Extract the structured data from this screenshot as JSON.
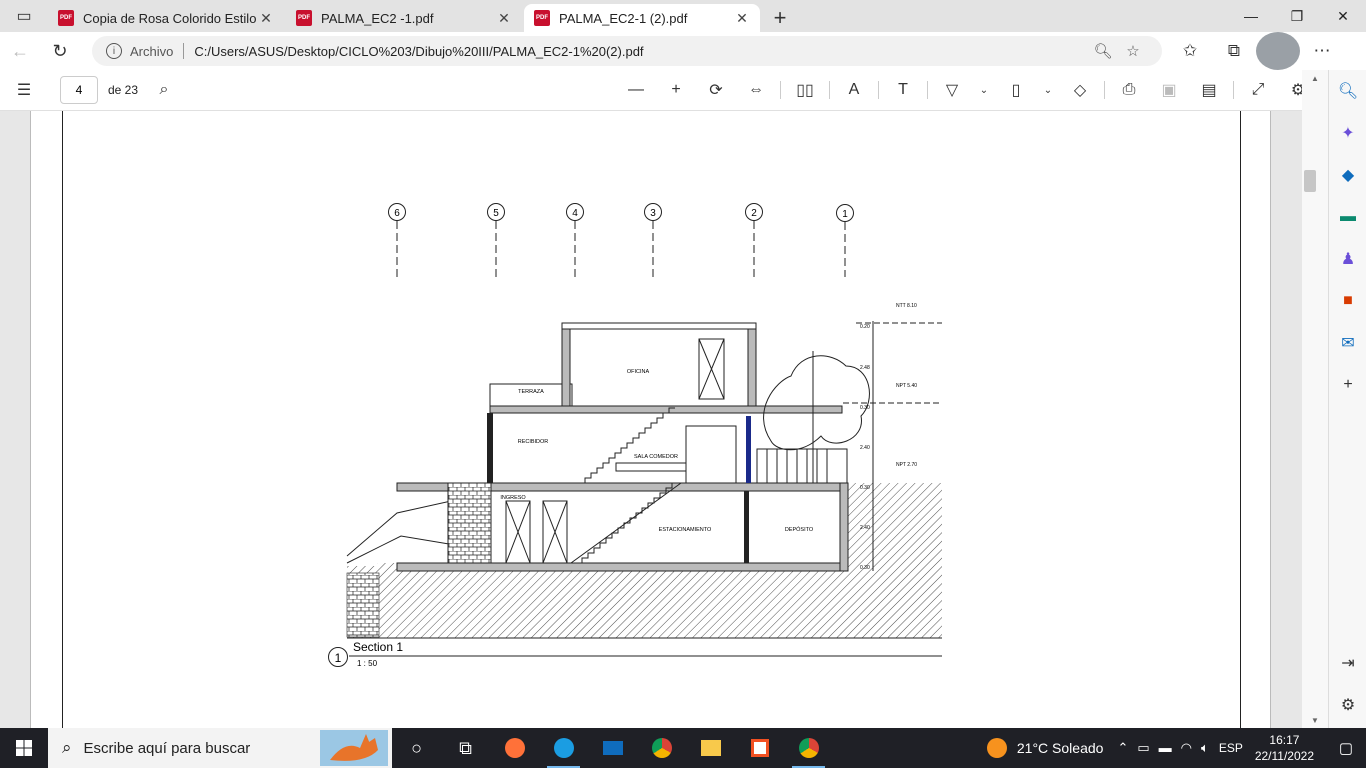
{
  "tabs": [
    {
      "title": "Copia de Rosa Colorido Estilo Se",
      "active": false
    },
    {
      "title": "PALMA_EC2 -1.pdf",
      "active": false
    },
    {
      "title": "PALMA_EC2-1 (2).pdf",
      "active": true
    }
  ],
  "address": {
    "label": "Archivo",
    "url": "C:/Users/ASUS/Desktop/CICLO%203/Dibujo%20III/PALMA_EC2-1%20(2).pdf"
  },
  "pdf_toolbar": {
    "page_number": "4",
    "page_total": "de 23"
  },
  "drawing": {
    "axes": [
      "6",
      "5",
      "4",
      "3",
      "2",
      "1"
    ],
    "levels": [
      "NTT 8.10",
      "NPT 5.40",
      "NPT 2.70"
    ],
    "dims": [
      "0.20",
      "2.48",
      "0.30",
      "2.40",
      "0.30",
      "2.40",
      "0.30"
    ],
    "rooms": [
      "OFICINA",
      "TERRAZA",
      "RECIBIDOR",
      "SALA COMEDOR",
      "INGRESO",
      "ESTACIONAMIENTO",
      "DEPÓSITO"
    ],
    "section_number": "1",
    "section_title": "Section 1",
    "scale": "1 : 50"
  },
  "taskbar": {
    "search_placeholder": "Escribe aquí para buscar",
    "weather": "21°C  Soleado",
    "lang": "ESP",
    "time": "16:17",
    "date": "22/11/2022"
  }
}
